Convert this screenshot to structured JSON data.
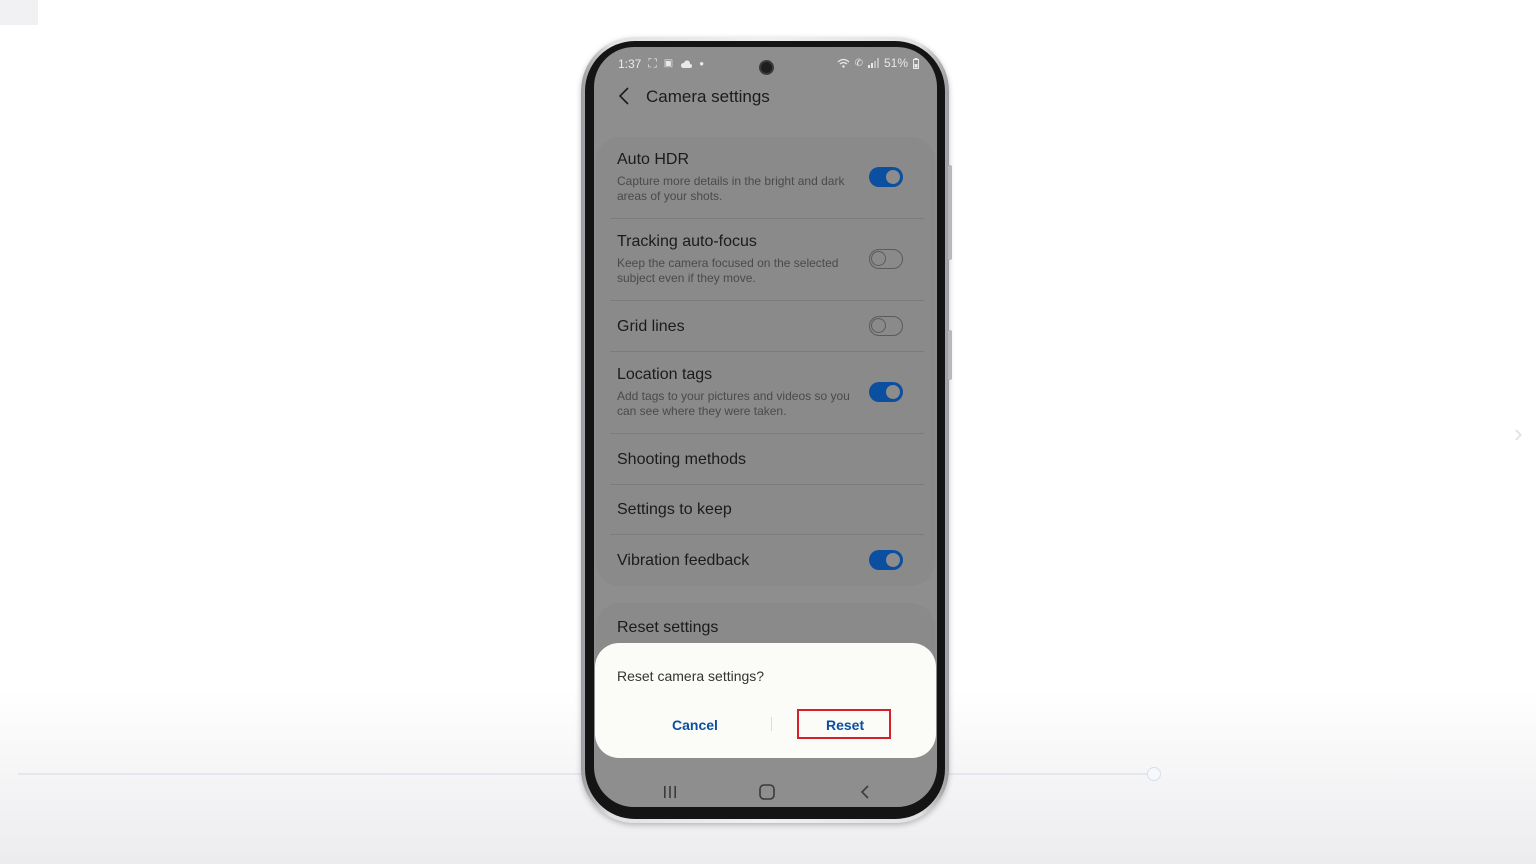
{
  "status_bar": {
    "time": "1:37",
    "battery": "51%",
    "left_icons": [
      "screen-record-icon",
      "screenshot-icon",
      "cloud-icon",
      "dot-icon"
    ],
    "right_icons": [
      "wifi-icon",
      "call-icon",
      "signal-icon",
      "battery-icon"
    ]
  },
  "header": {
    "title": "Camera settings"
  },
  "settings": [
    {
      "title": "Auto HDR",
      "subtitle": "Capture more details in the bright and dark areas of your shots.",
      "toggle": true
    },
    {
      "title": "Tracking auto-focus",
      "subtitle": "Keep the camera focused on the selected subject even if they move.",
      "toggle": false
    },
    {
      "title": "Grid lines",
      "toggle": false
    },
    {
      "title": "Location tags",
      "subtitle": "Add tags to your pictures and videos so you can see where they were taken.",
      "toggle": true
    },
    {
      "title": "Shooting methods"
    },
    {
      "title": "Settings to keep"
    },
    {
      "title": "Vibration feedback",
      "toggle": true
    }
  ],
  "reset_section": {
    "title": "Reset settings"
  },
  "dialog": {
    "question": "Reset camera settings?",
    "cancel_label": "Cancel",
    "reset_label": "Reset"
  },
  "colors": {
    "accent": "#0b4fa0",
    "highlight": "#d5202a",
    "dimmed_screen": "#8e8e8e",
    "dialog_bg": "#fbfbf8"
  }
}
